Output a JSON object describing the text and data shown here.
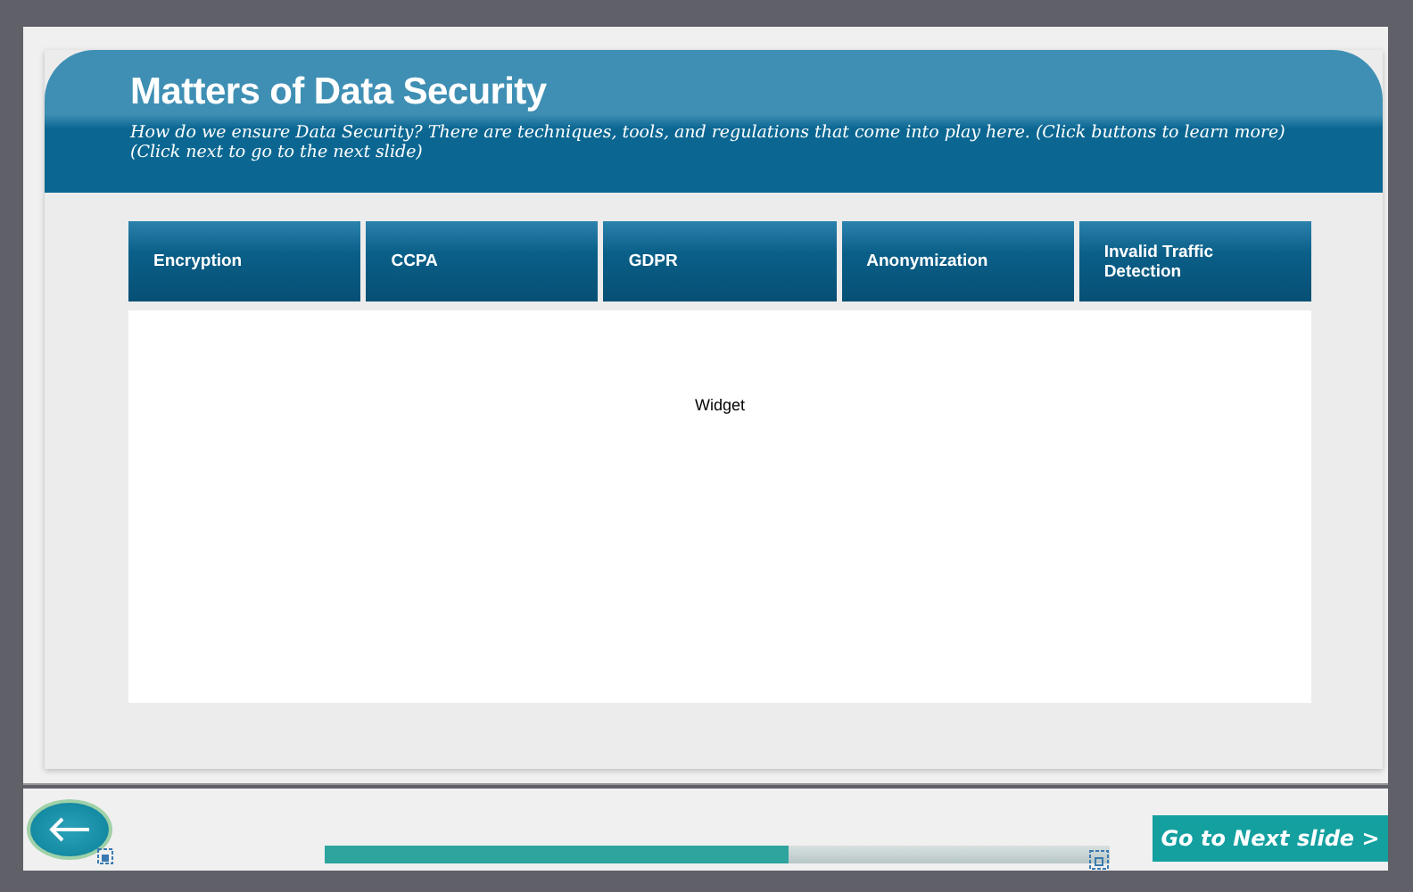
{
  "slide": {
    "title": "Matters of Data Security",
    "subtitle": "How do we ensure Data Security?  There are techniques, tools, and regulations that come into play here. (Click buttons to learn more) (Click next to go to the next slide)",
    "tabs": [
      {
        "label": "Encryption"
      },
      {
        "label": "CCPA"
      },
      {
        "label": "GDPR"
      },
      {
        "label": "Anonymization"
      },
      {
        "label": "Invalid Traffic Detection"
      }
    ],
    "widget": {
      "label": "Widget"
    }
  },
  "footer": {
    "progress": {
      "level": 0.59
    },
    "next_button": "Go to Next slide >"
  }
}
